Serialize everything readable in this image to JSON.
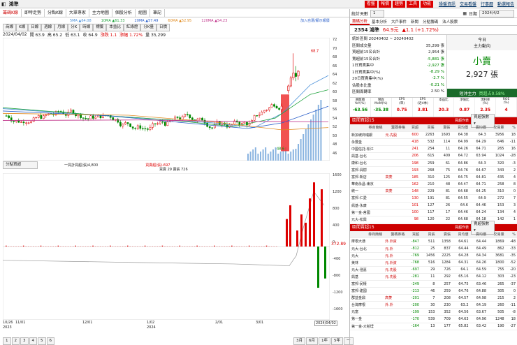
{
  "top": {
    "symbol": "鴻準",
    "buttons": [
      "看盤",
      "報價",
      "趨勢",
      "工具",
      "功能"
    ]
  },
  "toolbar_tabs": [
    "籌碼K線",
    "即時走勢",
    "分點K線",
    "大單專家",
    "主力地圖",
    "個股分析",
    "組圖",
    "筆記"
  ],
  "ma_legend": [
    "5MA ▲64.08",
    "10MA ▲61.33",
    "20MA ▲57.49",
    "60MA ▲52.95",
    "120MA ▲54.23"
  ],
  "ma_colors": [
    "#4a90d9",
    "#1fa33d",
    "#2b5fc9",
    "#e08a1e",
    "#c0338a"
  ],
  "watch_link": "加入自選/顯示報價",
  "chart_tabs": [
    "商線",
    "K線",
    "日線",
    "週線",
    "月線",
    "分K",
    "時線",
    "標籤",
    "本益比",
    "紅綠燈",
    "分K量",
    "日價"
  ],
  "ohlc": {
    "date": "2024/04/02",
    "open": "開 63.9",
    "high": "高 65.2",
    "low": "低 63.1",
    "close": "收 64.9",
    "chg": "漲跌 1.1",
    "pct": "漲幅 1.72%",
    "vol": "量 35,299"
  },
  "price_axis": [
    "72",
    "70",
    "68",
    "66",
    "64",
    "62",
    "60",
    "58",
    "56",
    "54",
    "52",
    "50",
    "48",
    "46"
  ],
  "peak_label": "68.7",
  "low_label": "48.6",
  "sub_legend": "一買計買超(張)4,800",
  "sub_legend2": "買賣超(張)-697",
  "sub_legend3": "買賣 29 賣張 726",
  "sub_axis": [
    "1600",
    "1200",
    "800",
    "400",
    "0",
    "-400",
    "-800",
    "-1200",
    "-1600"
  ],
  "sub_value": "372.89",
  "x_axis": [
    "10/26",
    "11/01",
    "12/01",
    "1/02",
    "2/01",
    "3/01",
    "2024/04/02"
  ],
  "x_year": [
    "2023",
    "",
    "",
    "2024",
    "",
    "",
    ""
  ],
  "pager": [
    "1",
    "2",
    "3",
    "4",
    "5",
    "6"
  ],
  "ranges": [
    "3月",
    "6月",
    "1年",
    "5年",
    "一"
  ],
  "sel_label": "分點買超",
  "right": {
    "stat_label": "統計天數",
    "stat_days": "1",
    "date_label": "日期",
    "date": "2024/4/2",
    "top_links": [
      "操盤資訊",
      "交易看盤",
      "行事曆",
      "動選報告"
    ],
    "tabs": [
      "籌碼分析",
      "基本分析",
      "大戶事件",
      "新聞",
      "分點籌碼",
      "法人股票"
    ],
    "quote": {
      "code_name": "2354 鴻準",
      "price": "64.9元",
      "chg": "▲1.1 (+1.72%)"
    },
    "period": "統計區間 20240402 ~ 20240402",
    "stats": [
      [
        "區間成交量",
        "35,299 張"
      ],
      [
        "買超前15名合計",
        "2,954 張"
      ],
      [
        "賣超前15名合計",
        "-5,881 張"
      ],
      [
        "1日買賣集中",
        "-2,927 張"
      ],
      [
        "1日買賣集中(%)",
        "-8.29 %"
      ],
      [
        "20日買賣集中(%)",
        "-2.7 %"
      ],
      [
        "佔股本比重",
        "-0.21 %"
      ],
      [
        "區間周轉率",
        "2.50 %"
      ]
    ],
    "main_title": "今日",
    "main_sub": "主力動向",
    "main_action": "小賣",
    "main_value": "2,927 張",
    "short_label": "短沖主力",
    "short_pct": "買超占0.58%",
    "metrics_h": [
      "買斷順\nYoY(%)",
      "營收\nMoM(%)",
      "EPS\n(單)",
      "EPS\n(近4季)",
      "本益比",
      "淨值比",
      "現利率\n(%)",
      "ROE\n(%)"
    ],
    "metrics_v": [
      "-63.56",
      "-35.38",
      "0.75",
      "3.81",
      "20.3",
      "0.87",
      "2.35",
      "4"
    ],
    "buy_title": "區間買超15",
    "sell_title": "區間賣超15",
    "sort": "買超作表",
    "cols": [
      "券商簡稱",
      "籌碼券格",
      "買超",
      "買張",
      "賣張",
      "買均價",
      "賣均價",
      "交易量",
      "%"
    ],
    "buy_rows": [
      [
        "新加坡商瑞銀",
        "元.先股",
        "600",
        "2263",
        "1693",
        "64.38",
        "64.3",
        "3956",
        "18"
      ],
      [
        "永豐金",
        "",
        "418",
        "532",
        "114",
        "64.99",
        "64.29",
        "646",
        "-11"
      ],
      [
        "中國信託-松江",
        "",
        "241",
        "254",
        "11",
        "64.26",
        "64.71",
        "265",
        "16"
      ],
      [
        "凱基-台北",
        "",
        "206",
        "615",
        "409",
        "64.72",
        "63.94",
        "1024",
        "-28"
      ],
      [
        "康和-台北",
        "",
        "198",
        "259",
        "61",
        "64.86",
        "64.3",
        "320",
        "-3"
      ],
      [
        "富邦-員樹",
        "",
        "193",
        "268",
        "75",
        "64.76",
        "64.67",
        "343",
        "2"
      ],
      [
        "富邦-新店",
        "高菱",
        "185",
        "310",
        "125",
        "64.75",
        "64.81",
        "435",
        "4"
      ],
      [
        "華南永昌-東京",
        "",
        "162",
        "210",
        "48",
        "64.47",
        "64.71",
        "258",
        "8"
      ],
      [
        "統一",
        "高菱",
        "148",
        "229",
        "81",
        "64.68",
        "64.25",
        "310",
        "0"
      ],
      [
        "富邦-仁愛",
        "",
        "130",
        "191",
        "81",
        "64.55",
        "64.9",
        "272",
        "7"
      ],
      [
        "凱基-永康",
        "",
        "101",
        "127",
        "26",
        "64.6",
        "64.46",
        "153",
        "3"
      ],
      [
        "第一金-莒國",
        "",
        "100",
        "117",
        "17",
        "64.46",
        "64.24",
        "134",
        "4"
      ],
      [
        "元大-松興",
        "",
        "98",
        "120",
        "22",
        "64.68",
        "64.18",
        "142",
        "1"
      ]
    ],
    "sell_rows": [
      [
        "摩根大通",
        "外.外資",
        "-847",
        "511",
        "1358",
        "64.61",
        "64.44",
        "1869",
        "-48"
      ],
      [
        "元大-台北",
        "元.外",
        "-812",
        "25",
        "837",
        "64.44",
        "64.49",
        "862",
        "-33"
      ],
      [
        "元大",
        "元.外",
        "-769",
        "1456",
        "2225",
        "64.28",
        "64.34",
        "3681",
        "-35"
      ],
      [
        "美林",
        "元.外資",
        "-768",
        "516",
        "1284",
        "64.31",
        "64.26",
        "1800",
        "-52"
      ],
      [
        "元大-澄嘉",
        "元.先股",
        "-697",
        "29",
        "726",
        "64.1",
        "64.59",
        "755",
        "-20"
      ],
      [
        "凱基",
        "元.先股",
        "-281",
        "11",
        "292",
        "65.16",
        "64.12",
        "303",
        "-23"
      ],
      [
        "富邦-民權",
        "",
        "-249",
        "8",
        "257",
        "64.75",
        "63.46",
        "265",
        "-37"
      ],
      [
        "富邦-建國",
        "",
        "-213",
        "46",
        "259",
        "64.76",
        "64.88",
        "305",
        "0"
      ],
      [
        "群益金鼎",
        "高菱",
        "-201",
        "7",
        "208",
        "64.57",
        "64.98",
        "215",
        "2"
      ],
      [
        "台灣摩根",
        "外.外",
        "-200",
        "30",
        "230",
        "63.2",
        "64.19",
        "260",
        "-11"
      ],
      [
        "元富",
        "",
        "-199",
        "153",
        "352",
        "64.56",
        "63.67",
        "505",
        "-8"
      ],
      [
        "第一金",
        "",
        "-170",
        "539",
        "709",
        "64.63",
        "64.96",
        "1248",
        "18"
      ],
      [
        "第一金-大稻埕",
        "",
        "-164",
        "13",
        "177",
        "65.82",
        "63.42",
        "190",
        "-27"
      ]
    ]
  },
  "chart_data": {
    "type": "candlestick",
    "title": "",
    "ylim": [
      46,
      72
    ],
    "candles_recent": [
      [
        60.8,
        62.1,
        60.2,
        61.8
      ],
      [
        61.8,
        63.9,
        61.5,
        63.5
      ],
      [
        63.5,
        68.7,
        63.0,
        64.5
      ],
      [
        64.5,
        66.0,
        62.8,
        63.8
      ],
      [
        63.9,
        65.2,
        63.1,
        64.9
      ]
    ],
    "sub_ylim": [
      -1600,
      1600
    ],
    "sub_recent": [
      1050,
      1400,
      -900,
      1250,
      -697
    ]
  }
}
